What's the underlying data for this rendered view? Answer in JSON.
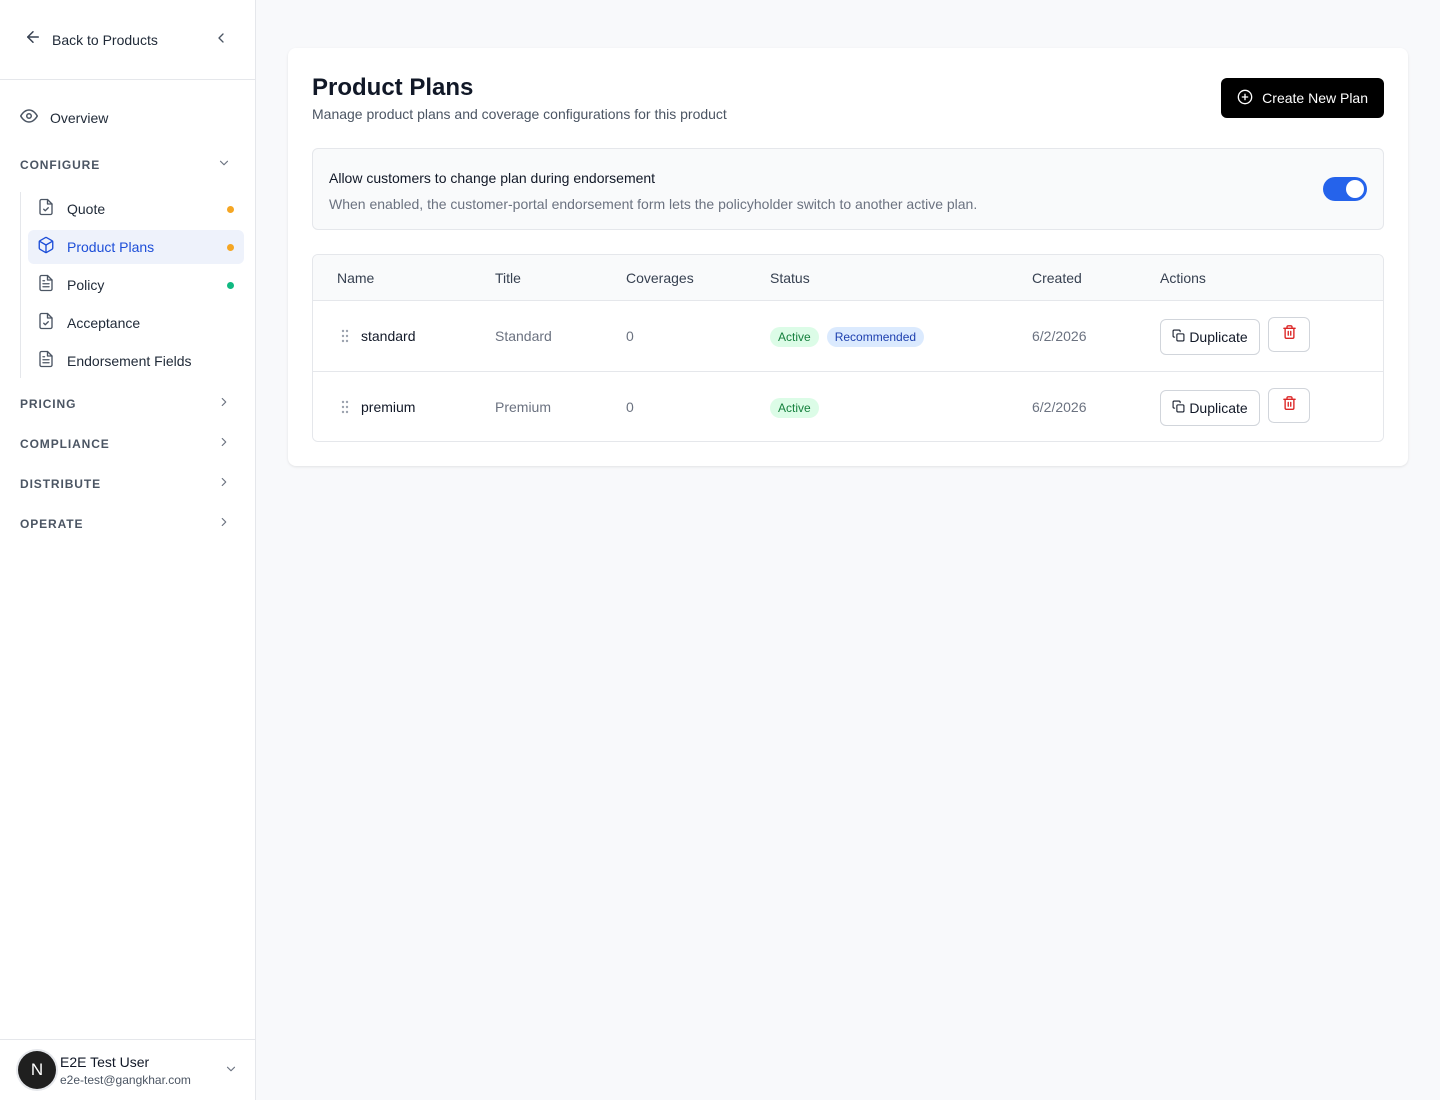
{
  "sidebar": {
    "back_label": "Back to Products",
    "overview_label": "Overview",
    "configure": {
      "label": "CONFIGURE",
      "items": [
        {
          "label": "Quote",
          "icon": "file-check-icon",
          "dot": "#f5a623"
        },
        {
          "label": "Product Plans",
          "icon": "cube-icon",
          "dot": "#f5a623",
          "active": true
        },
        {
          "label": "Policy",
          "icon": "file-text-icon",
          "dot": "#10b981"
        },
        {
          "label": "Acceptance",
          "icon": "file-check-icon",
          "dot": null
        },
        {
          "label": "Endorsement Fields",
          "icon": "file-text-icon",
          "dot": null
        }
      ]
    },
    "sections": [
      {
        "label": "PRICING"
      },
      {
        "label": "COMPLIANCE"
      },
      {
        "label": "DISTRIBUTE"
      },
      {
        "label": "OPERATE"
      }
    ],
    "user": {
      "initial": "N",
      "name": "E2E Test User",
      "email": "e2e-test@gangkhar.com"
    }
  },
  "header": {
    "title": "Product Plans",
    "subtitle": "Manage product plans and coverage configurations for this product",
    "create_label": "Create New Plan"
  },
  "setting": {
    "title": "Allow customers to change plan during endorsement",
    "description": "When enabled, the customer-portal endorsement form lets the policyholder switch to another active plan.",
    "enabled": true
  },
  "table": {
    "columns": [
      "Name",
      "Title",
      "Coverages",
      "Status",
      "Created",
      "Actions"
    ],
    "rows": [
      {
        "name": "standard",
        "title": "Standard",
        "coverages": "0",
        "status": "Active",
        "recommended": "Recommended",
        "created": "6/2/2026",
        "duplicate": "Duplicate"
      },
      {
        "name": "premium",
        "title": "Premium",
        "coverages": "0",
        "status": "Active",
        "recommended": null,
        "created": "6/2/2026",
        "duplicate": "Duplicate"
      }
    ]
  },
  "colors": {
    "accent": "#2563eb",
    "active_nav_bg": "#eef2fb",
    "active_nav_text": "#1d4ed8",
    "badge_active_bg": "#dcfce7",
    "badge_active_text": "#15803d",
    "badge_rec_bg": "#dbeafe",
    "badge_rec_text": "#1e40af",
    "delete_red": "#dc2626"
  }
}
